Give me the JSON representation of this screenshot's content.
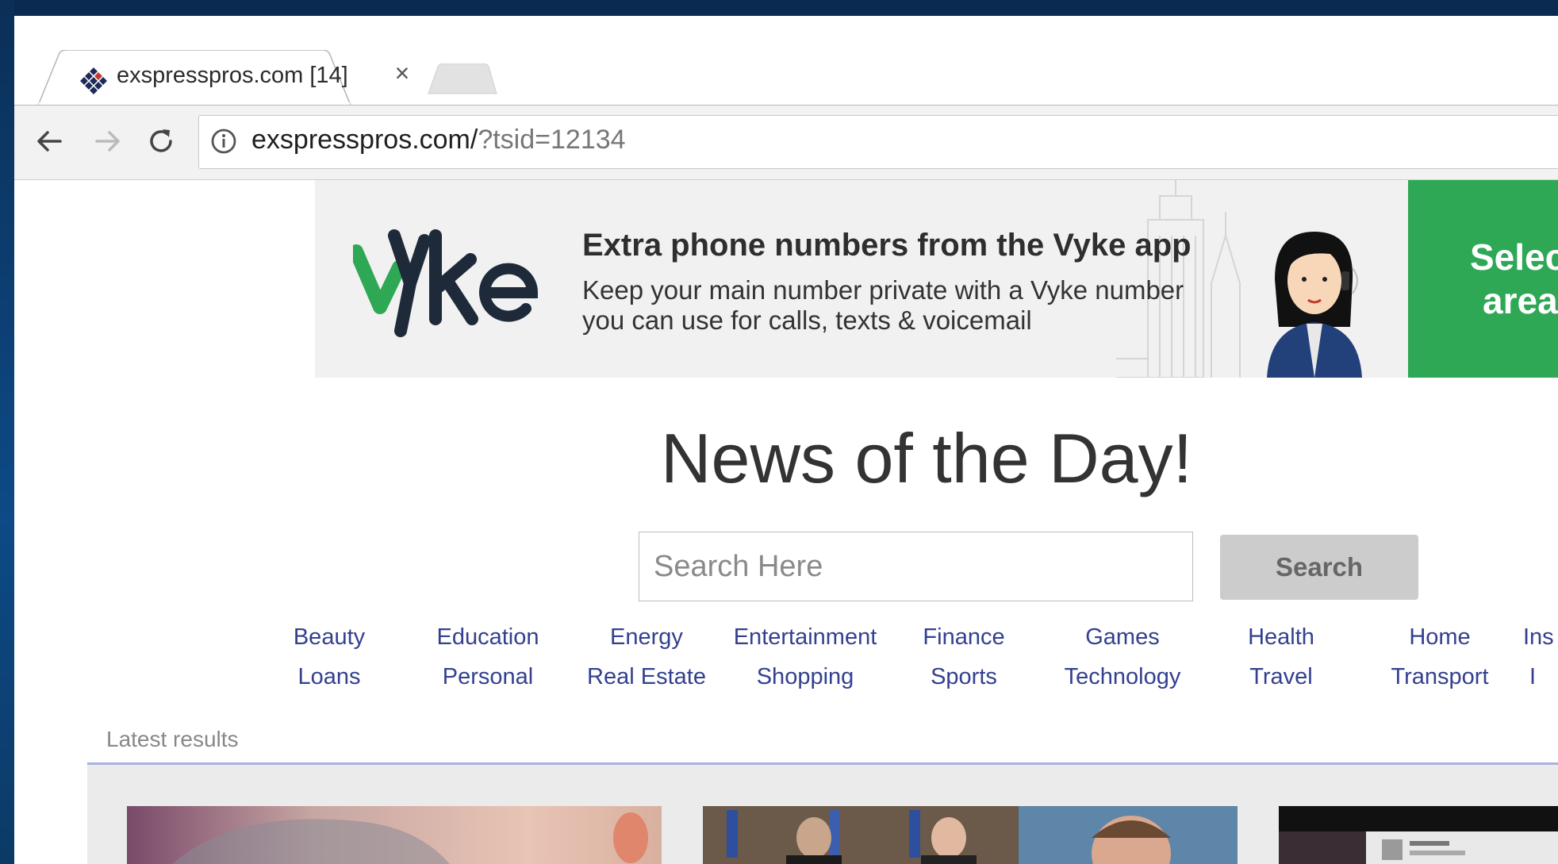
{
  "browser": {
    "tab": {
      "title": "exspresspros.com [14]",
      "close_glyph": "×"
    },
    "nav": {
      "back": "←",
      "forward": "→",
      "reload": "↻"
    },
    "address_bar": {
      "host_path": "exspresspros.com/",
      "query": "?tsid=12134"
    }
  },
  "ad": {
    "brand": "Vyke",
    "headline": "Extra phone numbers from the Vyke app",
    "body_line1": "Keep your main number private with a Vyke number",
    "body_line2": "you can use for calls, texts & voicemail",
    "cta_line1": "Select",
    "cta_line2": "area",
    "colors": {
      "brand_green": "#2fa856",
      "logo_dark": "#1e2a3a",
      "banner_bg": "#f0f1f0"
    }
  },
  "main": {
    "headline": "News of the Day!",
    "search": {
      "placeholder": "Search Here",
      "button_label": "Search"
    }
  },
  "categories": {
    "row1": [
      "Beauty",
      "Education",
      "Energy",
      "Entertainment",
      "Finance",
      "Games",
      "Health",
      "Home",
      "Ins"
    ],
    "row2": [
      "Loans",
      "Personal",
      "Real Estate",
      "Shopping",
      "Sports",
      "Technology",
      "Travel",
      "Transport",
      "I"
    ]
  },
  "latest": {
    "label": "Latest results"
  },
  "colors": {
    "category_link": "#33408f",
    "divider": "#aab0e0",
    "search_button_bg": "#cccccc"
  }
}
